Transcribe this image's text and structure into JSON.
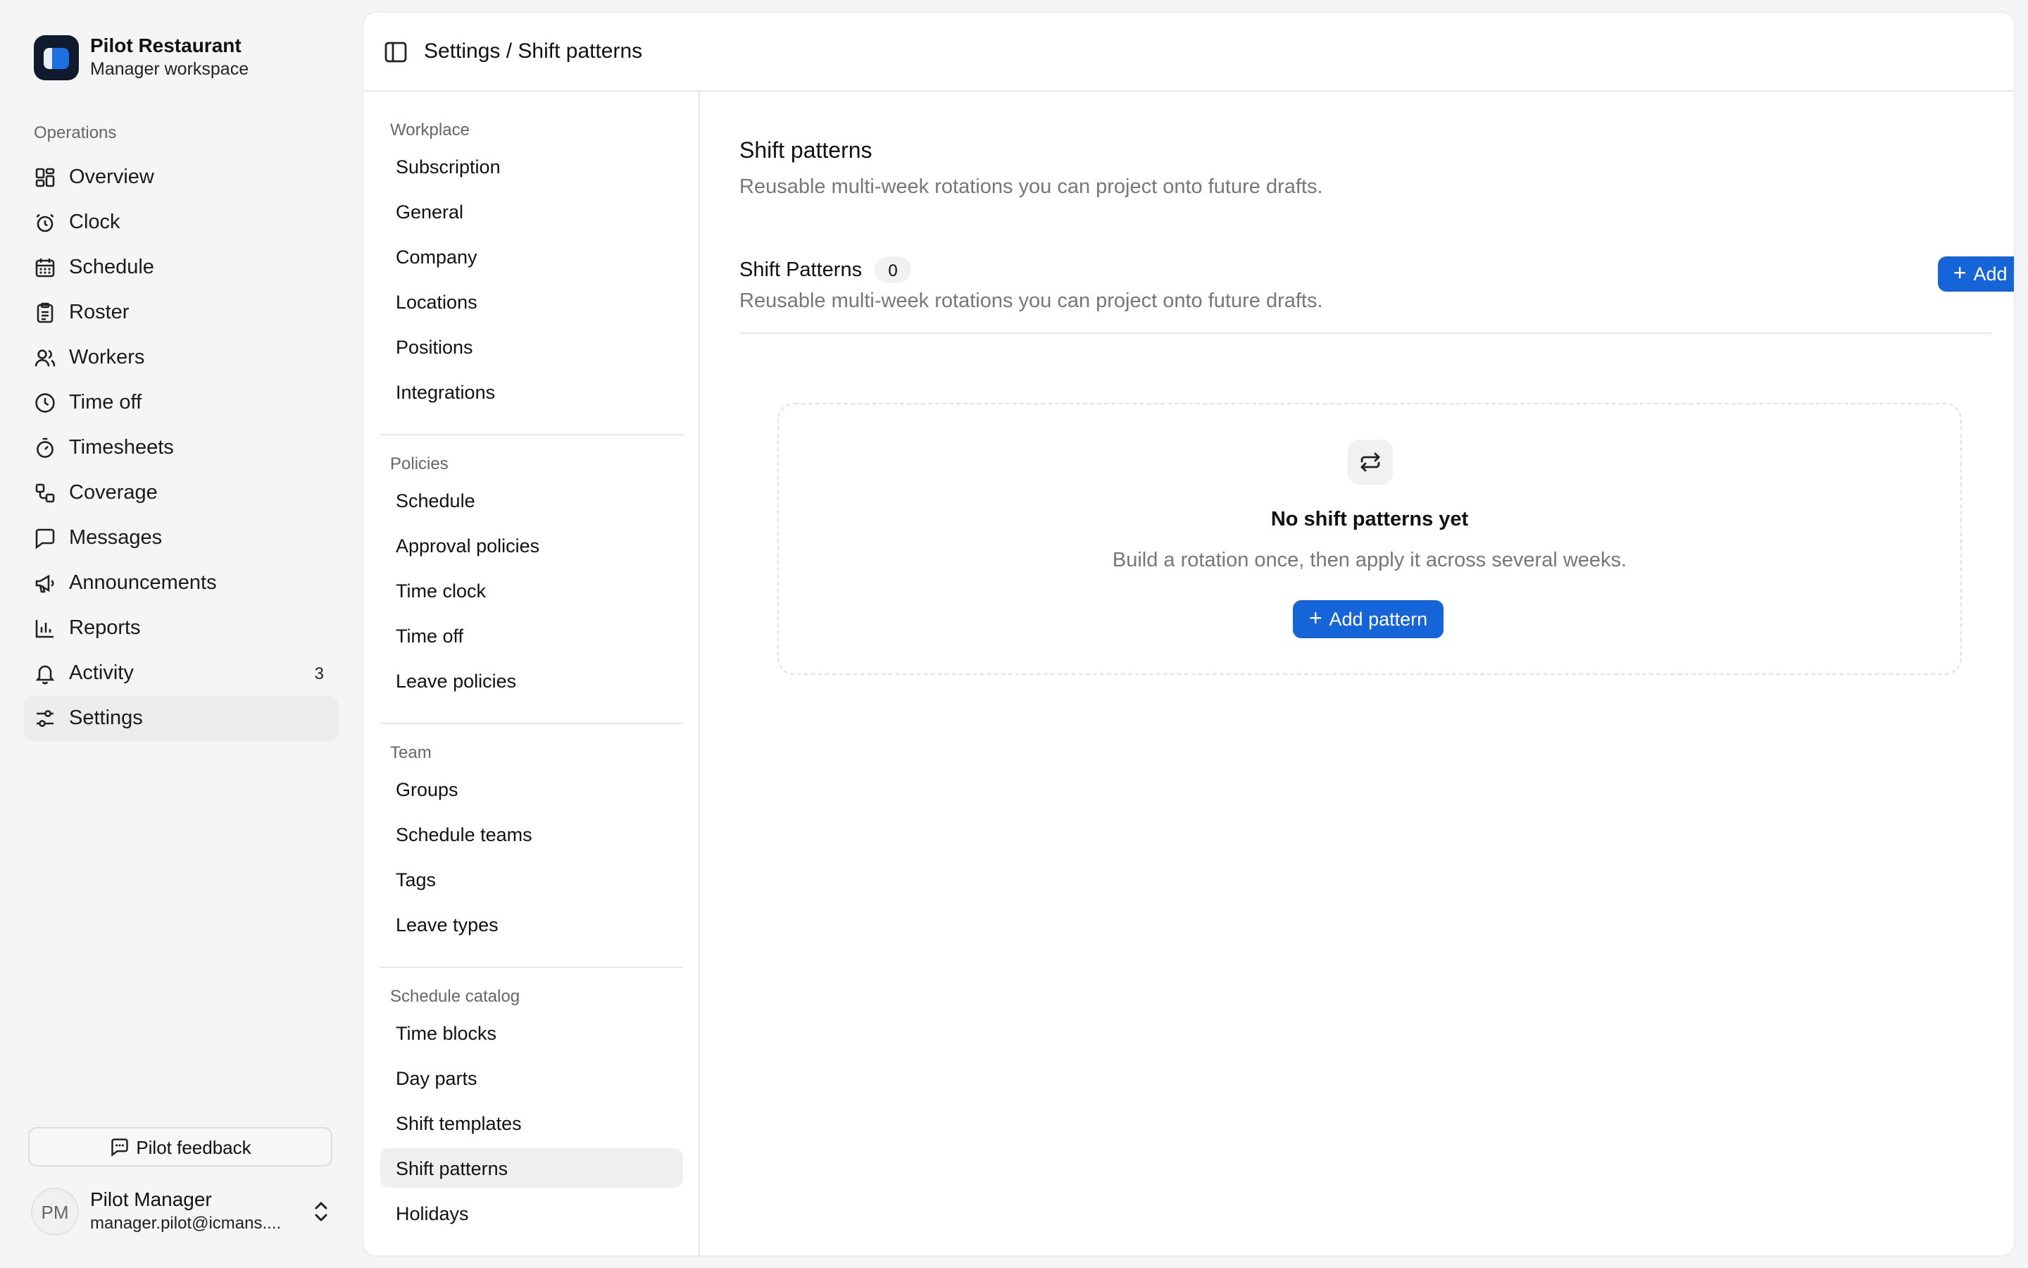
{
  "brand": {
    "name": "Pilot Restaurant",
    "subtitle": "Manager workspace"
  },
  "sidebar": {
    "section": "Operations",
    "items": [
      {
        "label": "Overview",
        "icon": "grid-icon"
      },
      {
        "label": "Clock",
        "icon": "alarm-clock-icon"
      },
      {
        "label": "Schedule",
        "icon": "calendar-icon"
      },
      {
        "label": "Roster",
        "icon": "clipboard-icon"
      },
      {
        "label": "Workers",
        "icon": "users-icon"
      },
      {
        "label": "Time off",
        "icon": "clock-icon"
      },
      {
        "label": "Timesheets",
        "icon": "stopwatch-icon"
      },
      {
        "label": "Coverage",
        "icon": "workflow-icon"
      },
      {
        "label": "Messages",
        "icon": "message-square-icon"
      },
      {
        "label": "Announcements",
        "icon": "megaphone-icon"
      },
      {
        "label": "Reports",
        "icon": "bar-chart-icon"
      },
      {
        "label": "Activity",
        "icon": "bell-icon",
        "badge": "3"
      },
      {
        "label": "Settings",
        "icon": "sliders-icon",
        "active": true
      }
    ],
    "feedback": "Pilot feedback",
    "user": {
      "initials": "PM",
      "name": "Pilot Manager",
      "email": "manager.pilot@icmans...."
    }
  },
  "header": {
    "breadcrumb": "Settings / Shift patterns"
  },
  "subnav": {
    "groups": [
      {
        "title": "Workplace",
        "items": [
          "Subscription",
          "General",
          "Company",
          "Locations",
          "Positions",
          "Integrations"
        ]
      },
      {
        "title": "Policies",
        "items": [
          "Schedule",
          "Approval policies",
          "Time clock",
          "Time off",
          "Leave policies"
        ]
      },
      {
        "title": "Team",
        "items": [
          "Groups",
          "Schedule teams",
          "Tags",
          "Leave types"
        ]
      },
      {
        "title": "Schedule catalog",
        "items": [
          "Time blocks",
          "Day parts",
          "Shift templates",
          "Shift patterns",
          "Holidays"
        ]
      }
    ],
    "active": "Shift patterns"
  },
  "main": {
    "title": "Shift patterns",
    "description": "Reusable multi‑week rotations you can project onto future drafts.",
    "section": {
      "title": "Shift Patterns",
      "count": "0",
      "description": "Reusable multi‑week rotations you can project onto future drafts.",
      "add_label": "Add pattern"
    },
    "empty": {
      "icon": "repeat-icon",
      "title": "No shift patterns yet",
      "description": "Build a rotation once, then apply it across several weeks.",
      "add_label": "Add pattern"
    }
  },
  "colors": {
    "accent": "#1565d8",
    "brand_dark": "#0f1b2d"
  }
}
